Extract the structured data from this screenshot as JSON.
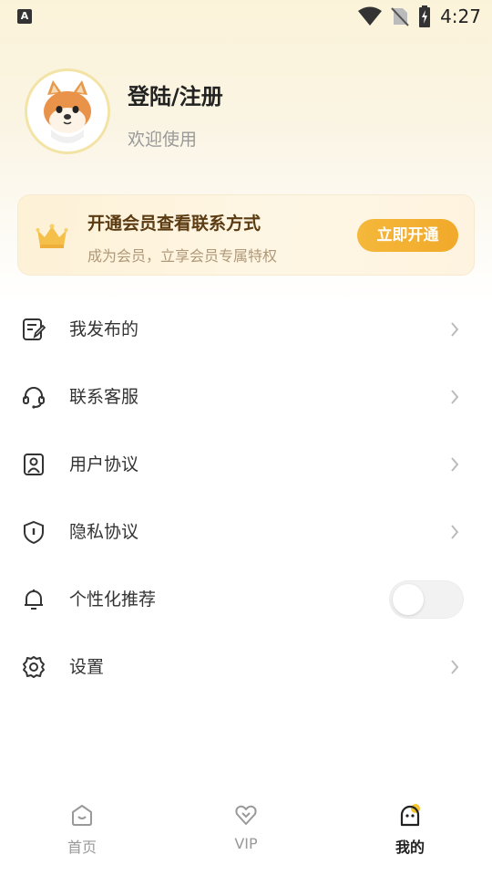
{
  "status_bar": {
    "app_icon_letter": "A",
    "time": "4:27"
  },
  "profile": {
    "title": "登陆/注册",
    "subtitle": "欢迎使用"
  },
  "vip_card": {
    "title": "开通会员查看联系方式",
    "subtitle": "成为会员，立享会员专属特权",
    "button": "立即开通"
  },
  "menu": [
    {
      "label": "我发布的",
      "icon": "edit-note-icon"
    },
    {
      "label": "联系客服",
      "icon": "headset-icon"
    },
    {
      "label": "用户协议",
      "icon": "user-agreement-icon"
    },
    {
      "label": "隐私协议",
      "icon": "privacy-shield-icon"
    },
    {
      "label": "个性化推荐",
      "icon": "bell-icon",
      "toggle": false
    },
    {
      "label": "设置",
      "icon": "gear-icon"
    }
  ],
  "bottom_nav": [
    {
      "label": "首页",
      "icon": "home-icon",
      "active": false
    },
    {
      "label": "VIP",
      "icon": "vip-heart-icon",
      "active": false
    },
    {
      "label": "我的",
      "icon": "mine-icon",
      "active": true
    }
  ],
  "colors": {
    "accent": "#f2ad2e",
    "vip_title": "#5b3b12"
  }
}
